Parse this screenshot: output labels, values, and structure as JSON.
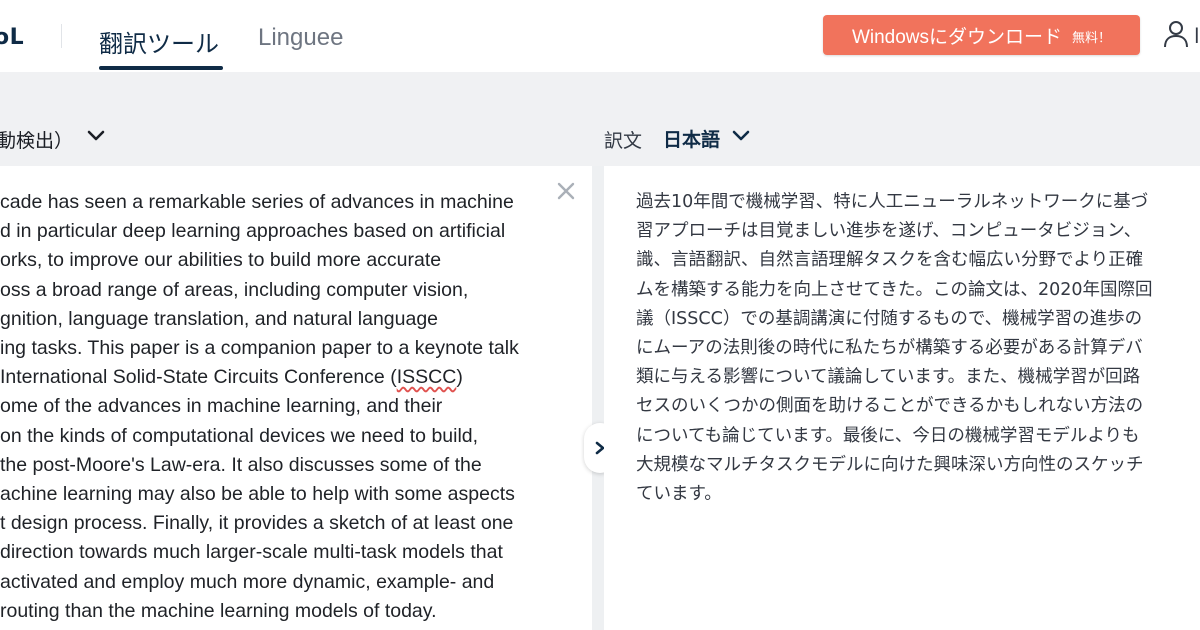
{
  "header": {
    "logo_text": "oL",
    "tabs": [
      {
        "label": "翻訳ツール",
        "active": true
      },
      {
        "label": "Linguee",
        "active": false
      }
    ],
    "download_button": {
      "label": "Windowsにダウンロード",
      "badge": "無料！"
    },
    "user_initial": "l"
  },
  "language_bar": {
    "source_language": "動検出）",
    "target_prefix": "訳文",
    "target_language": "日本語"
  },
  "source_lines": [
    "cade has seen a remarkable series of advances in machine",
    "d in particular deep learning approaches based on artificial",
    "orks, to improve our abilities to build more accurate",
    "oss a broad range of areas, including computer vision,",
    "gnition, language translation, and natural language",
    "ing tasks. This paper is a companion paper to a keynote talk",
    "International Solid-State Circuits Conference (",
    "ISSCC",
    ")",
    "ome of the advances in machine learning, and their",
    " on the kinds of computational devices we need to build,",
    " the post-Moore's Law-era. It also discusses some of the",
    "achine learning may also be able to help with some aspects",
    "t design process. Finally, it provides a sketch of at least one",
    "direction towards much larger-scale multi-task models that",
    " activated and employ much more dynamic, example- and",
    "routing than the machine learning models of today."
  ],
  "target_lines": [
    "過去10年間で機械学習、特に人工ニューラルネットワークに基づ",
    "習アプローチは目覚ましい進歩を遂げ、コンピュータビジョン、",
    "識、言語翻訳、自然言語理解タスクを含む幅広い分野でより正確",
    "ムを構築する能力を向上させてきた。この論文は、2020年国際回",
    "議（ISSCC）での基調講演に付随するもので、機械学習の進歩の",
    "にムーアの法則後の時代に私たちが構築する必要がある計算デバ",
    "類に与える影響について議論しています。また、機械学習が回路",
    "セスのいくつかの側面を助けることができるかもしれない方法の",
    "についても論じています。最後に、今日の機械学習モデルよりも",
    "大規模なマルチタスクモデルに向けた興味深い方向性のスケッチ",
    "ています。"
  ],
  "colors": {
    "accent": "#f1735c",
    "brand": "#0f2b46",
    "langbar_bg": "#f0f1f3"
  },
  "icons": {
    "clear": "close-icon",
    "swap": "chevron-right-icon",
    "user": "user-icon",
    "dropdown": "chevron-down-icon"
  }
}
